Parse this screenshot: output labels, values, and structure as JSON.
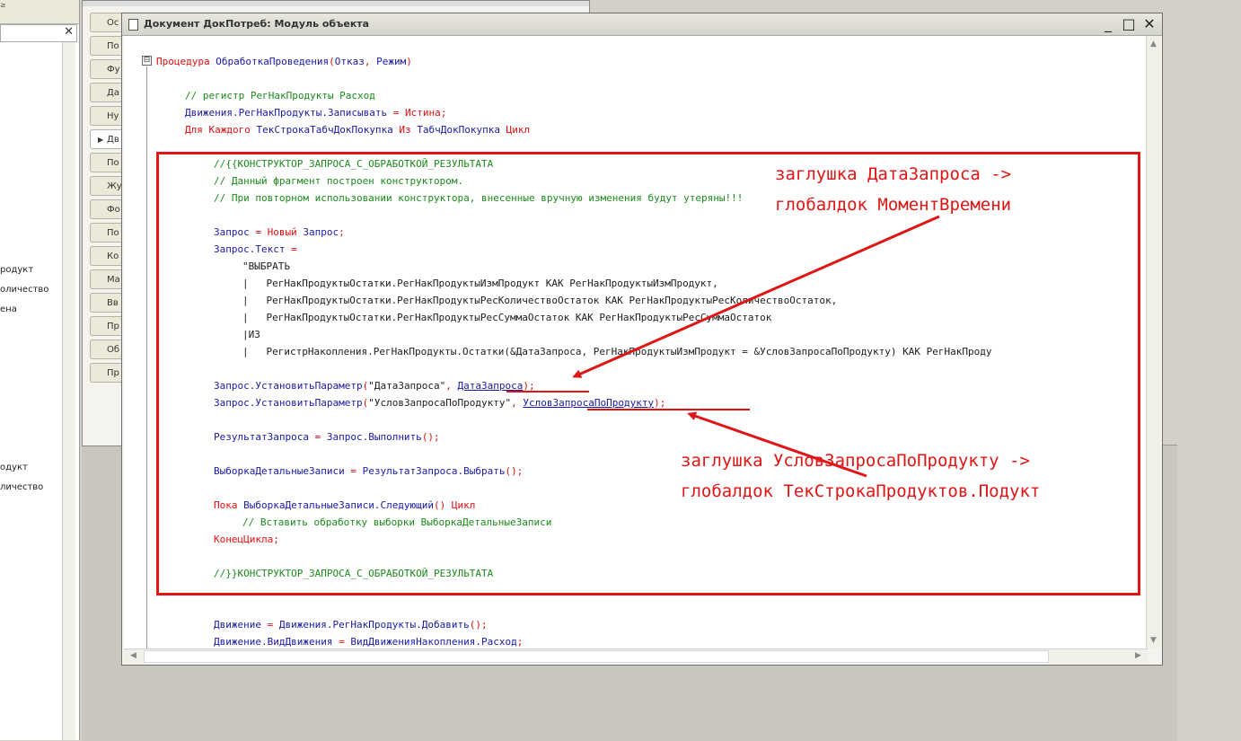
{
  "window": {
    "title": "Документ ДокПотреб: Модуль объекта",
    "minimize": "_",
    "maximize": "□",
    "close": "✕"
  },
  "left_panel": {
    "tiny_text": "≥",
    "close": "✕",
    "tree_items": [
      "родукт",
      "оличество",
      "ена",
      "одукт",
      "личество"
    ]
  },
  "bg_tabs": [
    "Ос",
    "По",
    "Фу",
    "Да",
    "Ну",
    "Дв",
    "По",
    "Жу",
    "Фо",
    "По",
    "Ко",
    "Ма",
    "Вв",
    "Пр",
    "Об",
    "Пр"
  ],
  "fold_marker": "⊟",
  "code": {
    "l1_proc": "Процедура",
    "l1_name": "ОбработкаПроведения",
    "l1_params_open": "(",
    "l1_p1": "Отказ",
    "l1_sep": ", ",
    "l1_p2": "Режим",
    "l1_close": ")",
    "l2": "// регистр РегНакПродукты Расход",
    "l3_a": "Движения.РегНакПродукты.Записывать",
    "l3_b": " = ",
    "l3_c": "Истина",
    "l3_d": ";",
    "l4_a": "Для Каждого ",
    "l4_b": "ТекСтрокаТабчДокПокупка",
    "l4_c": " Из ",
    "l4_d": "ТабчДокПокупка",
    "l4_e": " Цикл",
    "c1": "//{{КОНСТРУКТОР_ЗАПРОСА_С_ОБРАБОТКОЙ_РЕЗУЛЬТАТА",
    "c2": "// Данный фрагмент построен конструктором.",
    "c3": "// При повторном использовании конструктора, внесенные вручную изменения будут утеряны!!!",
    "q1_a": "Запрос",
    "q1_b": " = Новый ",
    "q1_c": "Запрос",
    "q1_d": ";",
    "q2_a": "Запрос.Текст",
    "q2_b": " =",
    "s1": "\"ВЫБРАТЬ",
    "s2": "|   РегНакПродуктыОстатки.РегНакПродуктыИзмПродукт КАК РегНакПродуктыИзмПродукт,",
    "s3": "|   РегНакПродуктыОстатки.РегНакПродуктыРесКоличествоОстаток КАК РегНакПродуктыРесКоличествоОстаток,",
    "s4": "|   РегНакПродуктыОстатки.РегНакПродуктыРесСуммаОстаток КАК РегНакПродуктыРесСуммаОстаток",
    "s5": "|ИЗ",
    "s6": "|   РегистрНакопления.РегНакПродукты.Остатки(&ДатаЗапроса, РегНакПродуктыИзмПродукт = &УсловЗапросаПоПродукту) КАК РегНакПроду",
    "p1_a": "Запрос.УстановитьПараметр",
    "p1_b": "(",
    "p1_c": "\"ДатаЗапроса\"",
    "p1_d": ", ",
    "p1_e": "ДатаЗапроса",
    "p1_f": ");",
    "p2_a": "Запрос.УстановитьПараметр",
    "p2_b": "(",
    "p2_c": "\"УсловЗапросаПоПродукту\"",
    "p2_d": ", ",
    "p2_e": "УсловЗапросаПоПродукту",
    "p2_f": ");",
    "r1_a": "РезультатЗапроса",
    "r1_b": " = ",
    "r1_c": "Запрос.Выполнить",
    "r1_d": "();",
    "v1_a": "ВыборкаДетальныеЗаписи",
    "v1_b": " = ",
    "v1_c": "РезультатЗапроса.Выбрать",
    "v1_d": "();",
    "w1_a": "Пока ",
    "w1_b": "ВыборкаДетальныеЗаписи.Следующий",
    "w1_c": "() Цикл",
    "w2": "// Вставить обработку выборки ВыборкаДетальныеЗаписи",
    "w3": "КонецЦикла;",
    "c4": "//}}КОНСТРУКТОР_ЗАПРОСА_С_ОБРАБОТКОЙ_РЕЗУЛЬТАТА",
    "m1_a": "Движение",
    "m1_b": " = ",
    "m1_c": "Движения.РегНакПродукты.Добавить",
    "m1_d": "();",
    "m2_a": "Движение.ВидДвижения",
    "m2_b": " = ",
    "m2_c": "ВидДвиженияНакопления.Расход",
    "m2_d": ";"
  },
  "annotations": {
    "a1_line1": "заглушка ДатаЗапроса ->",
    "a1_line2": "глобалдок МоментВремени",
    "a2_line1": "заглушка УсловЗапросаПоПродукту ->",
    "a2_line2": "глобалдок ТекСтрокаПродуктов.Подукт"
  },
  "colors": {
    "keyword": "#e01010",
    "identifier": "#1a1aa8",
    "comment": "#1a8a1a",
    "annotation": "#e01515"
  }
}
